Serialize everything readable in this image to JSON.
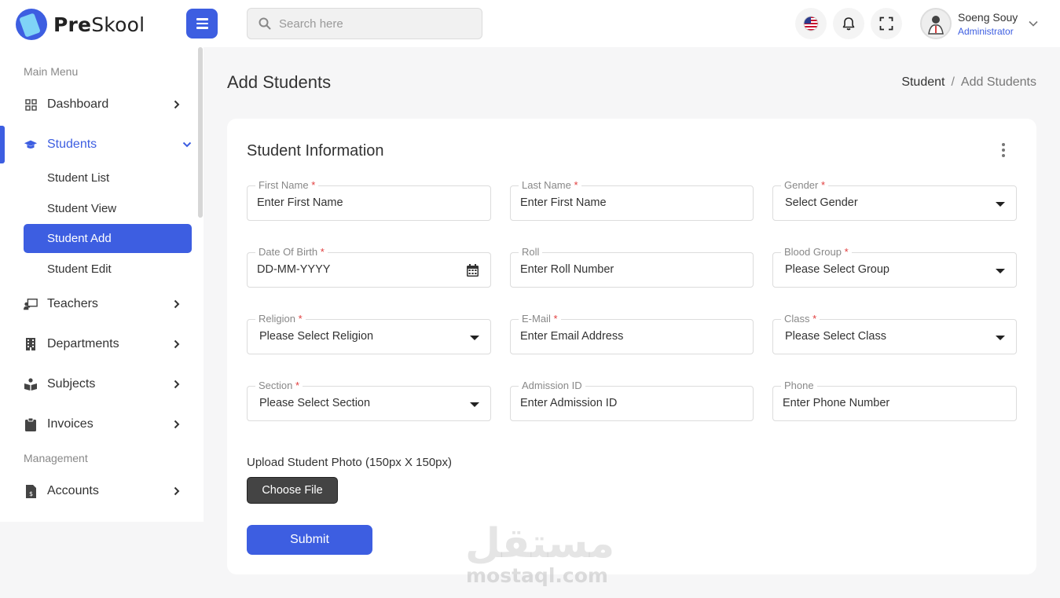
{
  "header": {
    "logo_pre": "Pre",
    "logo_post": "Skool",
    "search_placeholder": "Search here",
    "user_name": "Soeng Souy",
    "user_role": "Administrator"
  },
  "sidebar": {
    "section_main": "Main Menu",
    "section_management": "Management",
    "items": [
      {
        "label": "Dashboard",
        "icon": "grid-icon"
      },
      {
        "label": "Students",
        "icon": "graduation-cap-icon"
      },
      {
        "label": "Teachers",
        "icon": "chalkboard-teacher-icon"
      },
      {
        "label": "Departments",
        "icon": "building-icon"
      },
      {
        "label": "Subjects",
        "icon": "book-reader-icon"
      },
      {
        "label": "Invoices",
        "icon": "clipboard-icon"
      },
      {
        "label": "Accounts",
        "icon": "file-invoice-dollar-icon"
      }
    ],
    "students_sub": [
      "Student List",
      "Student View",
      "Student Add",
      "Student Edit"
    ]
  },
  "page": {
    "title": "Add Students",
    "breadcrumb": [
      "Student",
      "/",
      "Add Students"
    ]
  },
  "card": {
    "title": "Student Information",
    "fields": [
      {
        "label": "First Name",
        "required": "*",
        "value": "Enter First Name"
      },
      {
        "label": "Last Name",
        "required": "*",
        "value": "Enter First Name"
      },
      {
        "label": "Gender",
        "required": "*",
        "value": "Select Gender"
      },
      {
        "label": "Date Of Birth",
        "required": "*",
        "value": "DD-MM-YYYY"
      },
      {
        "label": "Roll",
        "required": "",
        "value": "Enter Roll Number"
      },
      {
        "label": "Blood Group",
        "required": "*",
        "value": "Please Select Group"
      },
      {
        "label": "Religion",
        "required": "*",
        "value": "Please Select Religion"
      },
      {
        "label": "E-Mail",
        "required": "*",
        "value": "Enter Email Address"
      },
      {
        "label": "Class",
        "required": "*",
        "value": "Please Select Class"
      },
      {
        "label": "Section",
        "required": "*",
        "value": "Please Select Section"
      },
      {
        "label": "Admission ID",
        "required": "",
        "value": "Enter Admission ID"
      },
      {
        "label": "Phone",
        "required": "",
        "value": "Enter Phone Number"
      }
    ],
    "upload_label": "Upload Student Photo (150px X 150px)",
    "choose_file": "Choose File",
    "submit": "Submit"
  },
  "watermark": {
    "arabic": "مستقل",
    "latin": "mostaql.com"
  },
  "colors": {
    "primary": "#3d5ee1",
    "required": "#e13d3d",
    "dark_button": "#444444"
  }
}
